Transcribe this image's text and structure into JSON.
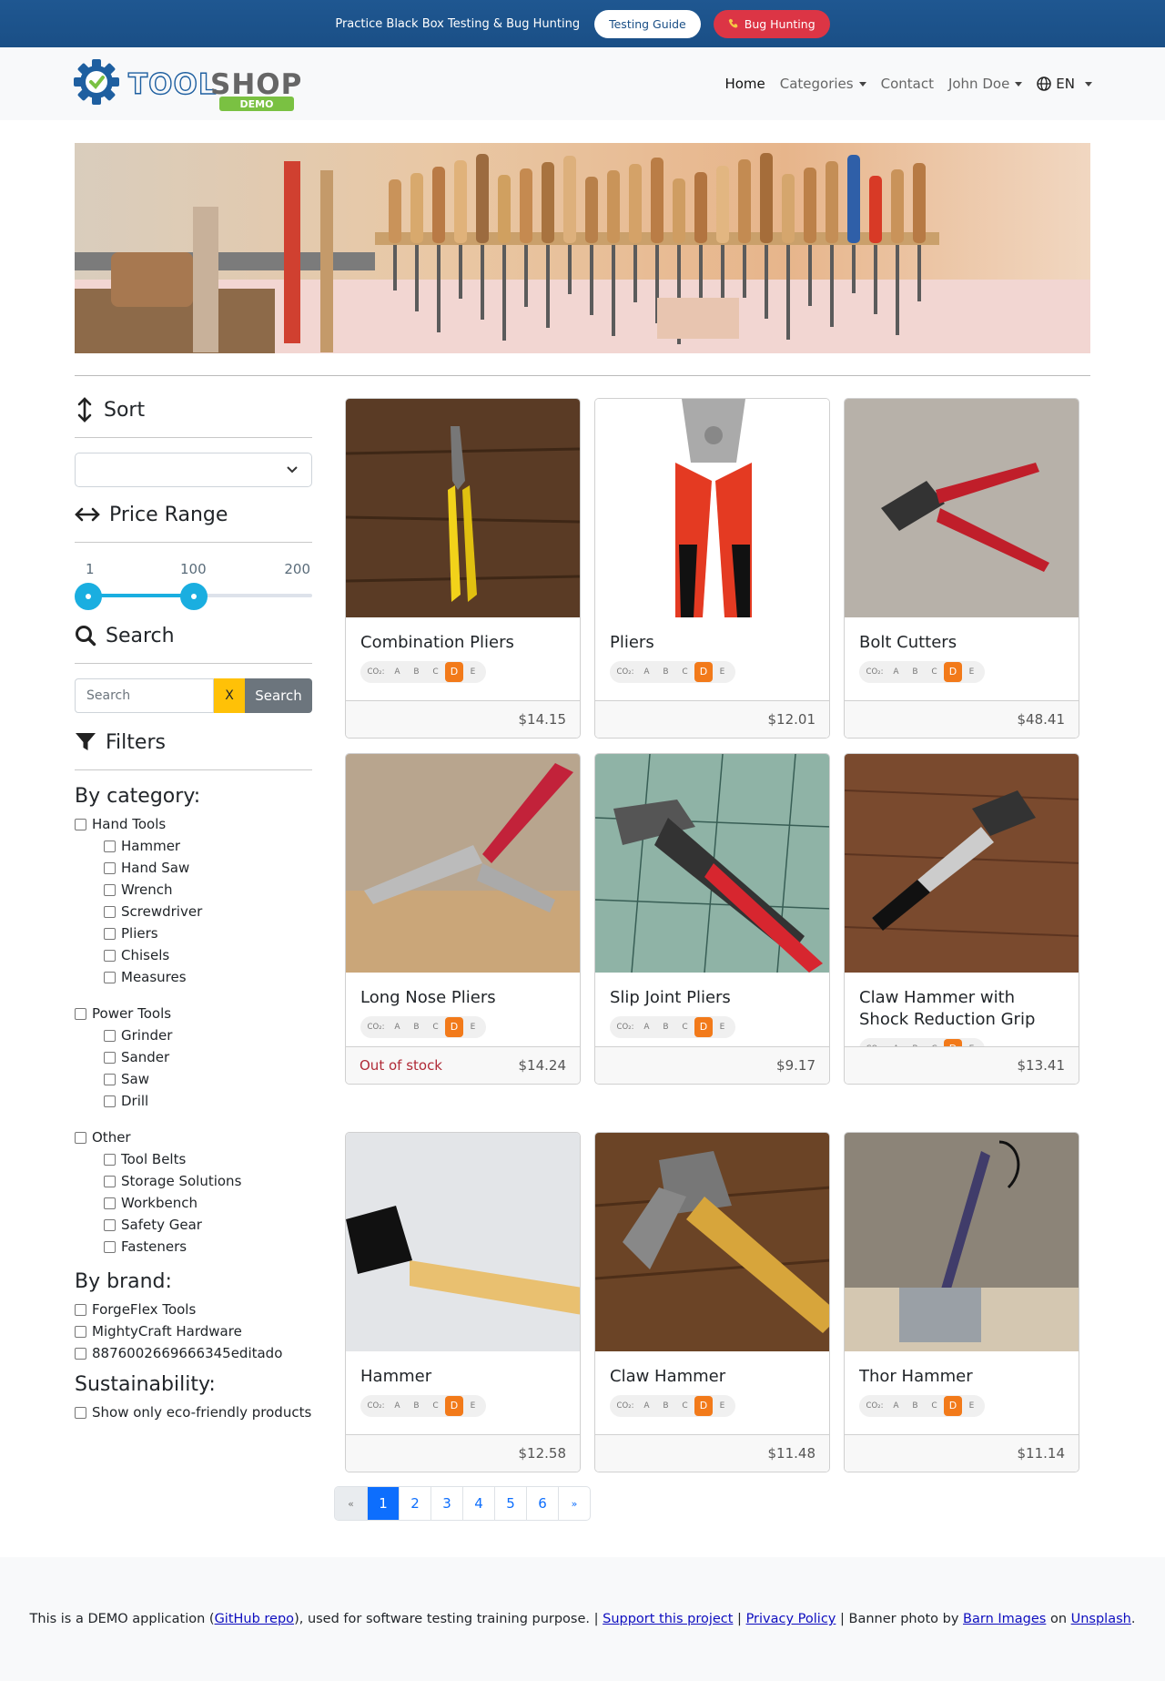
{
  "topbar": {
    "text": "Practice Black Box Testing & Bug Hunting",
    "testing_guide": "Testing Guide",
    "bug_hunting": "Bug Hunting",
    "bug_color": "#dc3545"
  },
  "logo": {
    "word": "TOOLSHOP",
    "badge": "DEMO"
  },
  "nav": {
    "home": "Home",
    "categories": "Categories",
    "contact": "Contact",
    "user": "John Doe",
    "lang": "EN"
  },
  "sidebar": {
    "sort_title": "Sort",
    "sort_value": "",
    "price_title": "Price Range",
    "price_min_label": "1",
    "price_mid_label": "100",
    "price_max_label": "200",
    "price_range": {
      "min": 1,
      "max": 200,
      "low": 1,
      "high": 100
    },
    "search_title": "Search",
    "search_placeholder": "Search",
    "search_clear": "X",
    "search_button": "Search",
    "filters_title": "Filters",
    "by_category": "By category:",
    "categories": [
      {
        "label": "Hand Tools",
        "children": [
          "Hammer",
          "Hand Saw",
          "Wrench",
          "Screwdriver",
          "Pliers",
          "Chisels",
          "Measures"
        ]
      },
      {
        "label": "Power Tools",
        "children": [
          "Grinder",
          "Sander",
          "Saw",
          "Drill"
        ]
      },
      {
        "label": "Other",
        "children": [
          "Tool Belts",
          "Storage Solutions",
          "Workbench",
          "Safety Gear",
          "Fasteners"
        ]
      }
    ],
    "by_brand": "By brand:",
    "brands": [
      "ForgeFlex Tools",
      "MightyCraft Hardware",
      "8876002669666345editado"
    ],
    "sustainability": "Sustainability:",
    "eco_only": "Show only eco-friendly products"
  },
  "eco_scale": {
    "label": "CO₂:",
    "grades": [
      "A",
      "B",
      "C",
      "D",
      "E"
    ],
    "active": "D",
    "active_color": "#f27a1a"
  },
  "products": [
    {
      "name": "Combination Pliers",
      "price": "$14.15",
      "stock": ""
    },
    {
      "name": "Pliers",
      "price": "$12.01",
      "stock": ""
    },
    {
      "name": "Bolt Cutters",
      "price": "$48.41",
      "stock": ""
    },
    {
      "name": "Long Nose Pliers",
      "price": "$14.24",
      "stock": "Out of stock"
    },
    {
      "name": "Slip Joint Pliers",
      "price": "$9.17",
      "stock": ""
    },
    {
      "name": "Claw Hammer with Shock Reduction Grip",
      "price": "$13.41",
      "stock": ""
    },
    {
      "name": "Hammer",
      "price": "$12.58",
      "stock": ""
    },
    {
      "name": "Claw Hammer",
      "price": "$11.48",
      "stock": ""
    },
    {
      "name": "Thor Hammer",
      "price": "$11.14",
      "stock": ""
    }
  ],
  "pagination": {
    "prev": "«",
    "pages": [
      "1",
      "2",
      "3",
      "4",
      "5",
      "6"
    ],
    "current": "1",
    "next": "»"
  },
  "footer": {
    "t1": "This is a DEMO application (",
    "github": "GitHub repo",
    "t2": "), used for software testing training purpose. | ",
    "support": "Support this project",
    "t3": " | ",
    "privacy": "Privacy Policy",
    "t4": " | Banner photo by ",
    "barn": "Barn Images",
    "t5": " on ",
    "unsplash": "Unsplash",
    "t6": "."
  }
}
